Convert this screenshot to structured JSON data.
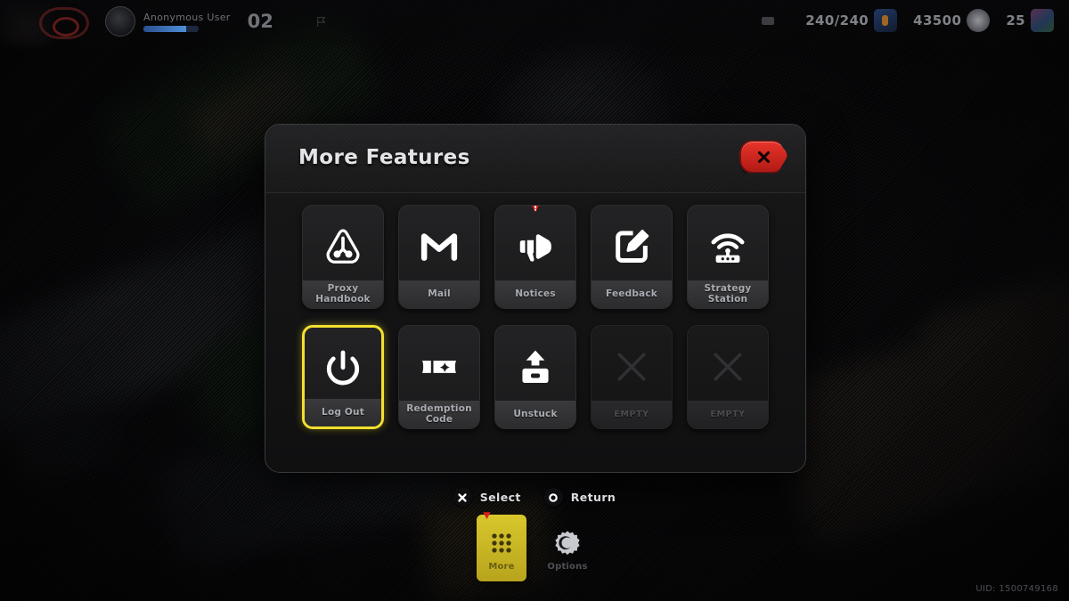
{
  "hud": {
    "logo_icon": "game-logo-icon",
    "avatar_icon": "player-avatar",
    "player_name": "Anonymous User",
    "player_level": "02",
    "flag_icon": "flag-icon",
    "ammo_icon": "ammo-icon",
    "currencies": [
      {
        "value": "240/240",
        "icon": "battery-currency-icon",
        "icon_id": "cur-ico-battery"
      },
      {
        "value": "43500",
        "icon": "coin-currency-icon",
        "icon_id": "cur-ico-coin"
      },
      {
        "value": "25",
        "icon": "card-currency-icon",
        "icon_id": "cur-ico-card"
      }
    ],
    "uid": "UID: 1500749168"
  },
  "panel": {
    "title": "More Features",
    "close_label": "Close",
    "close_icon": "close-x-icon",
    "rows": [
      [
        {
          "label": "Proxy\nHandbook",
          "icon": "proxy-handbook-icon",
          "empty": false,
          "selected": false,
          "badge": false
        },
        {
          "label": "Mail",
          "icon": "mail-icon",
          "empty": false,
          "selected": false,
          "badge": false
        },
        {
          "label": "Notices",
          "icon": "megaphone-icon",
          "empty": false,
          "selected": false,
          "badge": true
        },
        {
          "label": "Feedback",
          "icon": "pencil-square-icon",
          "empty": false,
          "selected": false,
          "badge": false
        },
        {
          "label": "Strategy\nStation",
          "icon": "wifi-router-icon",
          "empty": false,
          "selected": false,
          "badge": false
        }
      ],
      [
        {
          "label": "Log Out",
          "icon": "power-icon",
          "empty": false,
          "selected": true,
          "badge": false
        },
        {
          "label": "Redemption\nCode",
          "icon": "ticket-star-icon",
          "empty": false,
          "selected": false,
          "badge": false
        },
        {
          "label": "Unstuck",
          "icon": "eject-icon",
          "empty": false,
          "selected": false,
          "badge": false
        },
        {
          "label": "EMPTY",
          "icon": "empty-slot-x-icon",
          "empty": true,
          "selected": false,
          "badge": false
        },
        {
          "label": "EMPTY",
          "icon": "empty-slot-x-icon",
          "empty": true,
          "selected": false,
          "badge": false
        }
      ]
    ]
  },
  "hints": [
    {
      "key_icon": "cross-button-icon",
      "label": "Select"
    },
    {
      "key_icon": "circle-button-icon",
      "label": "Return"
    }
  ],
  "dock": [
    {
      "label": "More",
      "icon": "grid-menu-icon",
      "active": true,
      "badge": true
    },
    {
      "label": "Options",
      "icon": "gear-icon",
      "active": false,
      "badge": false
    }
  ],
  "colors": {
    "selection_yellow": "#f3e02e",
    "close_red": "#e8342a",
    "badge_red": "#e01f1f",
    "dock_active_yellow": "#d8c72c",
    "panel_bg": "#131314",
    "tile_bg": "#232325"
  }
}
